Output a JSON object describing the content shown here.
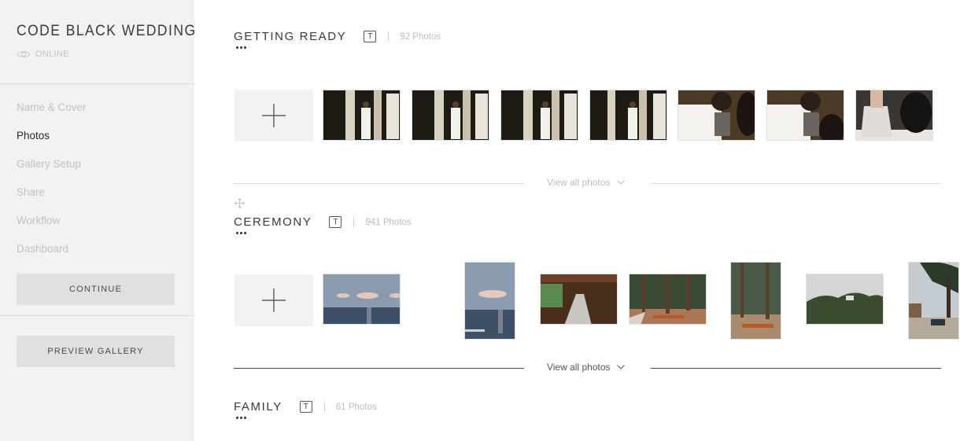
{
  "sidebar": {
    "gallery_title": "CODE BLACK WEDDING",
    "status": {
      "icon": "eye-icon",
      "label": "ONLINE"
    },
    "nav": [
      {
        "label": "Name & Cover",
        "active": false
      },
      {
        "label": "Photos",
        "active": true
      },
      {
        "label": "Gallery Setup",
        "active": false
      },
      {
        "label": "Share",
        "active": false
      },
      {
        "label": "Workflow",
        "active": false
      },
      {
        "label": "Dashboard",
        "active": false
      }
    ],
    "continue_label": "CONTINUE",
    "preview_label": "PREVIEW GALLERY"
  },
  "sets": [
    {
      "title": "GETTING READY",
      "title_icon": "T",
      "count": "92 Photos",
      "view_all": "View all photos",
      "photos": [
        {
          "subject": "bride by window",
          "orientation": "landscape"
        },
        {
          "subject": "bride by window",
          "orientation": "landscape"
        },
        {
          "subject": "bride by window",
          "orientation": "landscape"
        },
        {
          "subject": "bride by window",
          "orientation": "landscape"
        },
        {
          "subject": "bride in robe",
          "orientation": "landscape"
        },
        {
          "subject": "bride in robe",
          "orientation": "landscape"
        },
        {
          "subject": "dress",
          "orientation": "landscape"
        }
      ]
    },
    {
      "title": "CEREMONY",
      "title_icon": "T",
      "count": "941 Photos",
      "view_all": "View all photos",
      "photos": [
        {
          "subject": "ocean sunset",
          "orientation": "landscape"
        },
        {
          "subject": "ocean sunset",
          "orientation": "portrait"
        },
        {
          "subject": "wooden porch",
          "orientation": "landscape"
        },
        {
          "subject": "forest seating",
          "orientation": "landscape"
        },
        {
          "subject": "forest seating",
          "orientation": "portrait"
        },
        {
          "subject": "tree line",
          "orientation": "landscape"
        },
        {
          "subject": "patio tree",
          "orientation": "portrait"
        }
      ]
    },
    {
      "title": "FAMILY",
      "title_icon": "T",
      "count": "61 Photos"
    }
  ],
  "colors": {
    "sidebar_bg": "#f2f2f2",
    "button_bg": "#e0e0e0",
    "active_text": "#2a2a2a",
    "muted_text": "#c2c2c2"
  }
}
